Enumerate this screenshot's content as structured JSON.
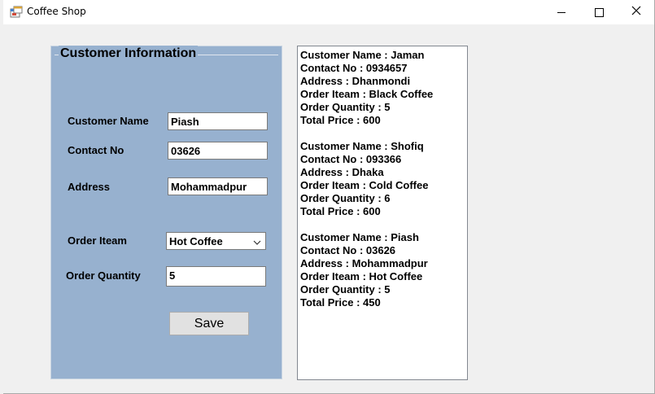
{
  "window": {
    "title": "Coffee Shop"
  },
  "group": {
    "title": "Customer Information"
  },
  "form": {
    "customer_name_label": "Customer Name",
    "customer_name_value": "Piash",
    "contact_label": "Contact No",
    "contact_value": "03626",
    "address_label": "Address",
    "address_value": "Mohammadpur",
    "order_item_label": "Order Iteam",
    "order_item_value": "Hot Coffee",
    "order_quantity_label": "Order Quantity",
    "order_quantity_value": "5",
    "save_label": "Save"
  },
  "orders": [
    {
      "name": "Customer Name : Jaman",
      "contact": "Contact No : 0934657",
      "address": "Address : Dhanmondi",
      "item": "Order Iteam : Black Coffee",
      "quantity": "Order Quantity : 5",
      "price": "Total Price : 600"
    },
    {
      "name": "Customer Name : Shofiq",
      "contact": "Contact No : 093366",
      "address": "Address : Dhaka",
      "item": "Order Iteam : Cold Coffee",
      "quantity": "Order Quantity : 6",
      "price": "Total Price : 600"
    },
    {
      "name": "Customer Name : Piash",
      "contact": "Contact No : 03626",
      "address": "Address : Mohammadpur",
      "item": "Order Iteam : Hot Coffee",
      "quantity": "Order Quantity : 5",
      "price": "Total Price : 450"
    }
  ],
  "colors": {
    "group_background": "#97b1cf",
    "window_background": "#f0f0f0"
  },
  "icons": {
    "app": "app-icon",
    "minimize": "minimize-icon",
    "maximize": "maximize-icon",
    "close": "close-icon",
    "dropdown": "chevron-down-icon"
  }
}
